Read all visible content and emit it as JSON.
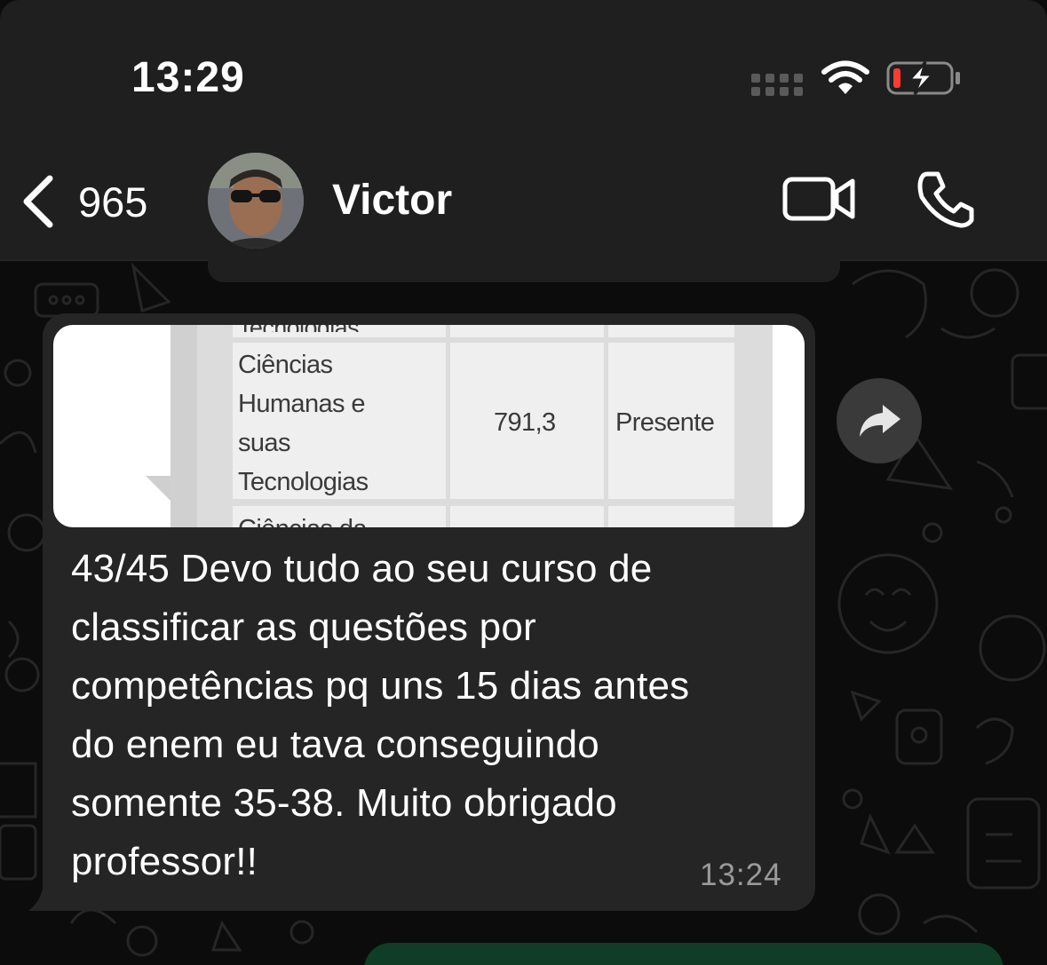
{
  "status_bar": {
    "time": "13:29"
  },
  "header": {
    "back_count": "965",
    "contact_name": "Victor"
  },
  "attachment": {
    "row_top_partial": "Tecnologias",
    "area_lines": [
      "Ciências",
      "Humanas e",
      "suas",
      "Tecnologias"
    ],
    "score": "791,3",
    "status": "Presente",
    "row_bottom_partial": "Ciências da"
  },
  "message": {
    "lines": [
      "43/45 Devo tudo ao seu curso de",
      "classificar as questões por",
      "competências pq uns 15 dias antes",
      "do enem eu tava conseguindo",
      "somente 35-38. Muito obrigado",
      "professor!!"
    ],
    "time": "13:24"
  },
  "colors": {
    "header_bg": "#1f1f1f",
    "incoming_bubble": "#252525",
    "outgoing_bubble": "#103d26",
    "battery_low": "#ff3b30"
  },
  "icons": [
    "chevron-left-icon",
    "video-camera-icon",
    "phone-icon",
    "forward-icon",
    "wifi-icon",
    "battery-charging-icon"
  ]
}
